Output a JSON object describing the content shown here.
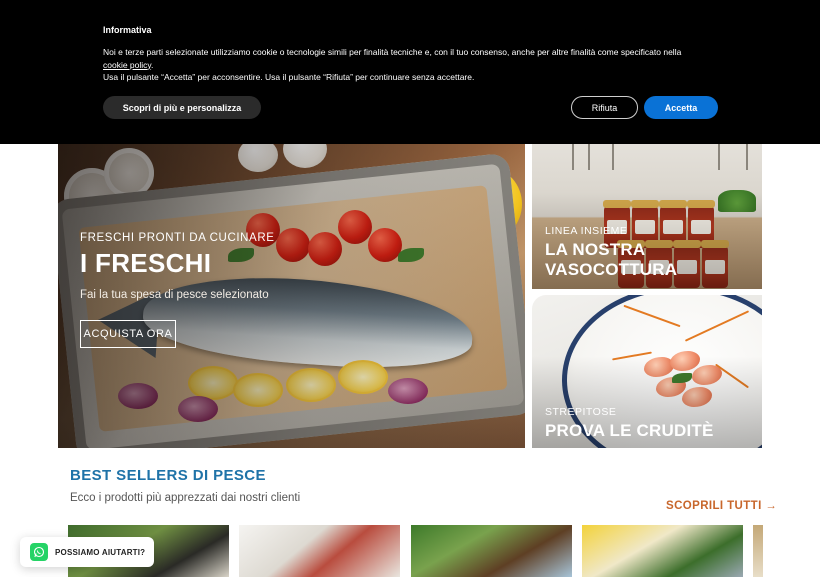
{
  "cookie_banner": {
    "title": "Informativa",
    "text_line1": "Noi e terze parti selezionate utilizziamo cookie o tecnologie simili per finalità tecniche e, con il tuo consenso, anche per altre finalità come specificato nella",
    "policy_link": "cookie policy",
    "text_line1_end": ".",
    "text_line2": "Usa il pulsante “Accetta” per acconsentire. Usa il pulsante “Rifiuta” per continuare senza accettare.",
    "customize_label": "Scopri di più e personalizza",
    "reject_label": "Rifiuta",
    "accept_label": "Accetta"
  },
  "hero": {
    "kicker": "FRESCHI PRONTI DA CUCINARE",
    "title": "I FRESCHI",
    "subtitle": "Fai la tua spesa di pesce selezionato",
    "cta_label": "ACQUISTA ORA"
  },
  "tiles": [
    {
      "kicker": "LINEA INSIEME",
      "title_line1": "LA NOSTRA",
      "title_line2": "VASOCOTTURA"
    },
    {
      "kicker": "STREPITOSE",
      "title_line1": "PROVA LE CRUDITÈ"
    }
  ],
  "best_sellers": {
    "title": "BEST SELLERS DI PESCE",
    "subtitle": "Ecco i prodotti più apprezzati dai nostri clienti",
    "see_all_label": "SCOPRILI TUTTI →"
  },
  "whatsapp": {
    "label": "POSSIAMO AIUTARTI?",
    "icon": "whatsapp-icon"
  },
  "colors": {
    "accent_blue": "#1f73a8",
    "accent_orange": "#c8662b",
    "accept_button": "#0a72d6",
    "whatsapp_green": "#25d366"
  }
}
